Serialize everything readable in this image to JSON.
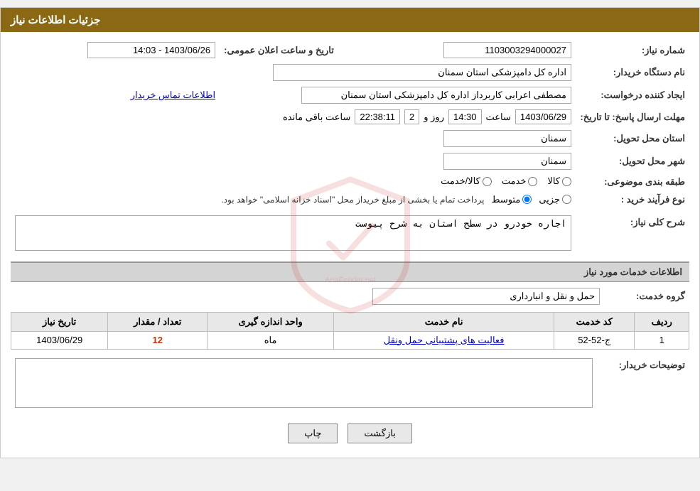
{
  "page": {
    "title": "جزئیات اطلاعات نیاز",
    "header_bg": "#8B6914"
  },
  "fields": {
    "need_number_label": "شماره نیاز:",
    "need_number_value": "1103003294000027",
    "buyer_org_label": "نام دستگاه خریدار:",
    "buyer_org_value": "اداره کل دامپزشکی استان سمنان",
    "creator_label": "ایجاد کننده درخواست:",
    "creator_value": "مصطفی اعرابی کاربرداز اداره کل دامپزشکی استان سمنان",
    "contact_link": "اطلاعات تماس خریدار",
    "announcement_label": "تاریخ و ساعت اعلان عمومی:",
    "announcement_value": "1403/06/26 - 14:03",
    "deadline_label": "مهلت ارسال پاسخ: تا تاریخ:",
    "deadline_date": "1403/06/29",
    "deadline_time_label": "ساعت",
    "deadline_time": "14:30",
    "deadline_days_label": "روز و",
    "deadline_days": "2",
    "deadline_remaining_label": "ساعت باقی مانده",
    "deadline_remaining": "22:38:11",
    "delivery_province_label": "استان محل تحویل:",
    "delivery_province_value": "سمنان",
    "delivery_city_label": "شهر محل تحویل:",
    "delivery_city_value": "سمنان",
    "category_label": "طبقه بندی موضوعی:",
    "category_goods": "کالا",
    "category_service": "خدمت",
    "category_goods_service": "کالا/خدمت",
    "purchase_type_label": "نوع فرآیند خرید :",
    "purchase_partial": "جزیی",
    "purchase_medium": "متوسط",
    "purchase_note": "پرداخت تمام یا بخشی از مبلغ خریداز محل \"اسناد خزانه اسلامی\" خواهد بود.",
    "summary_label": "شرح کلی نیاز:",
    "summary_value": "اجاره خودرو در سطح استان به شرح پیوست",
    "services_section_label": "اطلاعات خدمات مورد نیاز",
    "service_group_label": "گروه خدمت:",
    "service_group_value": "حمل و نقل و انبارداری",
    "table_headers": {
      "row_num": "ردیف",
      "service_code": "کد خدمت",
      "service_name": "نام خدمت",
      "unit": "واحد اندازه گیری",
      "quantity": "تعداد / مقدار",
      "date": "تاریخ نیاز"
    },
    "table_rows": [
      {
        "row_num": "1",
        "service_code": "ج-52-52",
        "service_name": "فعالیت های پشتیبانی حمل ونقل",
        "unit": "ماه",
        "quantity": "12",
        "date": "1403/06/29"
      }
    ],
    "buyer_desc_label": "توضیحات خریدار:",
    "buyer_desc_value": "",
    "btn_back": "بازگشت",
    "btn_print": "چاپ"
  }
}
